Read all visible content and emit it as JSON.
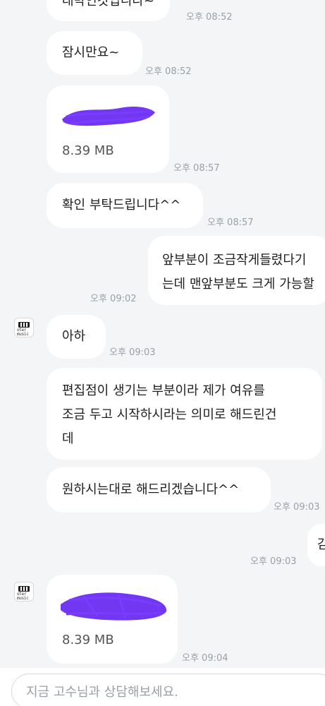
{
  "messages": [
    {
      "text": "대박인것입니다~",
      "time": "오후 08:52"
    },
    {
      "text": "잠시만요~",
      "time": "오후 08:52"
    },
    {
      "file_size": "8.39 MB",
      "time": "오후 08:57"
    },
    {
      "text": "확인 부탁드립니다^^",
      "time": "오후 08:57"
    },
    {
      "lines": [
        "앞부분이 조금작게들렸다기",
        "는데 맨앞부분도 크게 가능할"
      ],
      "time": "오후 09:02"
    },
    {
      "avatar_label": [
        "oter",
        "music"
      ],
      "text": "아하",
      "time": "오후 09:03"
    },
    {
      "lines": [
        "편집점이 생기는 부분이라 제가 여유를",
        "조금 두고 시작하시라는 의미로 해드린건",
        "데"
      ]
    },
    {
      "text": "원하시는대로 해드리겠습니다^^",
      "time": "오후 09:03"
    },
    {
      "text": "감",
      "time": "오후 09:03"
    },
    {
      "avatar_label": [
        "oter",
        "music"
      ],
      "file_size": "8.39 MB",
      "time": "오후 09:04"
    }
  ],
  "composer": {
    "placeholder": "지금 고수님과 상담해보세요."
  },
  "colors": {
    "background": "#f4f5f7",
    "bubble": "#ffffff",
    "scribble": "#6a2cf0",
    "time_text": "#9aa0a6"
  }
}
